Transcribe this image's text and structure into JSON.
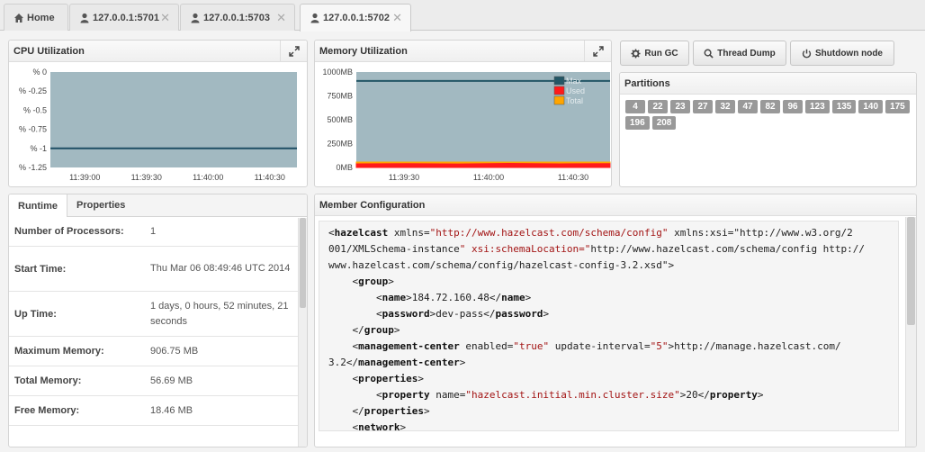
{
  "tabs": [
    {
      "label": "Home",
      "icon": "home-icon",
      "closable": false
    },
    {
      "label": "127.0.0.1:5701",
      "icon": "user-icon",
      "closable": true
    },
    {
      "label": "127.0.0.1:5703",
      "icon": "user-icon",
      "closable": true
    },
    {
      "label": "127.0.0.1:5702",
      "icon": "user-icon",
      "closable": true,
      "active": true
    }
  ],
  "cpu": {
    "title": "CPU Utilization",
    "chart_data": {
      "type": "area",
      "title": "CPU Utilization",
      "y_ticks": [
        "% 0",
        "% -0.25",
        "% -0.5",
        "% -0.75",
        "% -1",
        "% -1.25"
      ],
      "ylim": [
        -1.25,
        0
      ],
      "x_ticks": [
        "11:39:00",
        "11:39:30",
        "11:40:00",
        "11:40:30"
      ],
      "series": [
        {
          "values": [
            -1,
            -1,
            -1,
            -1,
            -1,
            -1
          ]
        }
      ],
      "colors": {
        "fill": "#a2b9c1",
        "line": "#1e4e64"
      }
    }
  },
  "memory": {
    "title": "Memory Utilization",
    "chart_data": {
      "type": "area",
      "title": "Memory Utilization",
      "y_ticks": [
        "1000MB",
        "750MB",
        "500MB",
        "250MB",
        "0MB"
      ],
      "ylim": [
        0,
        1000
      ],
      "x_ticks": [
        "11:39:30",
        "11:40:00",
        "11:40:30"
      ],
      "legend": "top-right",
      "series": [
        {
          "name": "Max",
          "values": [
            906.75,
            906.75,
            906.75,
            906.75,
            906.75,
            906.75
          ],
          "color": "#245766"
        },
        {
          "name": "Used",
          "values": [
            38,
            40,
            36,
            42,
            38,
            40
          ],
          "color": "#ff1a1a"
        },
        {
          "name": "Total",
          "values": [
            56.69,
            56.69,
            56.69,
            56.69,
            56.69,
            56.69
          ],
          "color": "#ffa500"
        }
      ]
    }
  },
  "actions": {
    "run_gc": "Run GC",
    "thread_dump": "Thread Dump",
    "shutdown": "Shutdown node"
  },
  "partitions": {
    "title": "Partitions",
    "items": [
      "4",
      "22",
      "23",
      "27",
      "32",
      "47",
      "82",
      "96",
      "123",
      "135",
      "140",
      "175",
      "196",
      "208"
    ]
  },
  "runtime": {
    "tabs": [
      "Runtime",
      "Properties"
    ],
    "rows": [
      {
        "label": "Number of Processors:",
        "value": "1"
      },
      {
        "label": "Start Time:",
        "value": "Thu Mar 06 08:49:46 UTC 2014"
      },
      {
        "label": "Up Time:",
        "value": "1 days, 0 hours, 52 minutes, 21 seconds"
      },
      {
        "label": "Maximum Memory:",
        "value": "906.75 MB"
      },
      {
        "label": "Total Memory:",
        "value": "56.69 MB"
      },
      {
        "label": "Free Memory:",
        "value": "18.46 MB"
      }
    ]
  },
  "config": {
    "title": "Member Configuration",
    "lines": [
      "<hazelcast xmlns=\"http://www.hazelcast.com/schema/config\" xmlns:xsi=\"http://www.w3.org/2",
      "001/XMLSchema-instance\" xsi:schemaLocation=\"http://www.hazelcast.com/schema/config http://",
      "www.hazelcast.com/schema/config/hazelcast-config-3.2.xsd\">",
      "    <group>",
      "        <name>184.72.160.48</name>",
      "        <password>dev-pass</password>",
      "    </group>",
      "    <management-center enabled=\"true\" update-interval=\"5\">http://manage.hazelcast.com/",
      "3.2</management-center>",
      "    <properties>",
      "        <property name=\"hazelcast.initial.min.cluster.size\">20</property>",
      "    </properties>",
      "    <network>"
    ]
  }
}
